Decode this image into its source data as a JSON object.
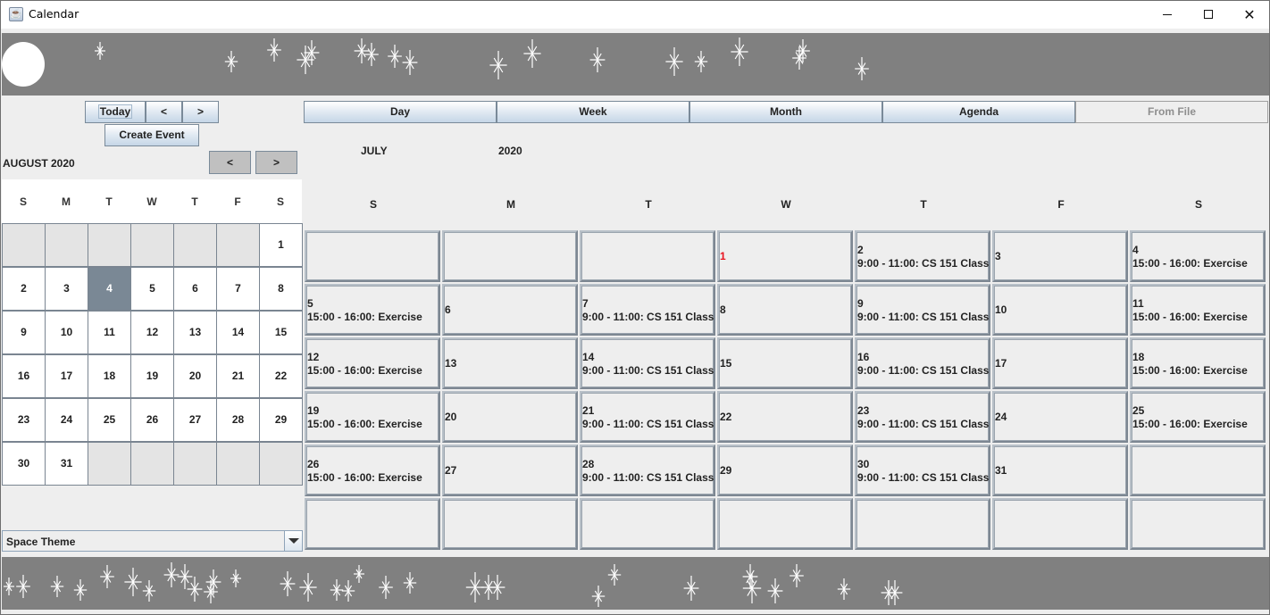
{
  "window": {
    "title": "Calendar",
    "icon": "java-cup-icon",
    "controls": {
      "minimize": "minimize-icon",
      "maximize": "maximize-icon",
      "close": "close-icon"
    }
  },
  "theme_colors": {
    "banner": "#808080",
    "stars": "#ffffff",
    "selected_day": "#7a8895",
    "today_text": "#e8121e",
    "background": "#eeeeee"
  },
  "sidebar": {
    "nav": {
      "today_label": "Today",
      "prev_label": "<",
      "next_label": ">"
    },
    "create_event_label": "Create Event",
    "mini_calendar": {
      "title": "AUGUST 2020",
      "prev_label": "<",
      "next_label": ">",
      "day_headers": [
        "S",
        "M",
        "T",
        "W",
        "T",
        "F",
        "S"
      ],
      "selected_day": "4",
      "weeks": [
        [
          "",
          "",
          "",
          "",
          "",
          "",
          "1"
        ],
        [
          "2",
          "3",
          "4",
          "5",
          "6",
          "7",
          "8"
        ],
        [
          "9",
          "10",
          "11",
          "12",
          "13",
          "14",
          "15"
        ],
        [
          "16",
          "17",
          "18",
          "19",
          "20",
          "21",
          "22"
        ],
        [
          "23",
          "24",
          "25",
          "26",
          "27",
          "28",
          "29"
        ],
        [
          "30",
          "31",
          "",
          "",
          "",
          "",
          ""
        ]
      ]
    },
    "theme_select": {
      "value": "Space Theme"
    }
  },
  "view_tabs": [
    {
      "label": "Day",
      "enabled": true
    },
    {
      "label": "Week",
      "enabled": true
    },
    {
      "label": "Month",
      "enabled": true
    },
    {
      "label": "Agenda",
      "enabled": true
    },
    {
      "label": "From File",
      "enabled": false
    }
  ],
  "month_view": {
    "month": "JULY",
    "year": "2020",
    "day_headers": [
      "S",
      "M",
      "T",
      "W",
      "T",
      "F",
      "S"
    ],
    "today": "1",
    "weeks": [
      [
        {
          "day": "",
          "event": ""
        },
        {
          "day": "",
          "event": ""
        },
        {
          "day": "",
          "event": ""
        },
        {
          "day": "1",
          "event": ""
        },
        {
          "day": "2",
          "event": "9:00 - 11:00: CS 151 Class"
        },
        {
          "day": "3",
          "event": ""
        },
        {
          "day": "4",
          "event": "15:00 - 16:00: Exercise"
        }
      ],
      [
        {
          "day": "5",
          "event": "15:00 - 16:00: Exercise"
        },
        {
          "day": "6",
          "event": ""
        },
        {
          "day": "7",
          "event": "9:00 - 11:00: CS 151 Class"
        },
        {
          "day": "8",
          "event": ""
        },
        {
          "day": "9",
          "event": "9:00 - 11:00: CS 151 Class"
        },
        {
          "day": "10",
          "event": ""
        },
        {
          "day": "11",
          "event": "15:00 - 16:00: Exercise"
        }
      ],
      [
        {
          "day": "12",
          "event": "15:00 - 16:00: Exercise"
        },
        {
          "day": "13",
          "event": ""
        },
        {
          "day": "14",
          "event": "9:00 - 11:00: CS 151 Class"
        },
        {
          "day": "15",
          "event": ""
        },
        {
          "day": "16",
          "event": "9:00 - 11:00: CS 151 Class"
        },
        {
          "day": "17",
          "event": ""
        },
        {
          "day": "18",
          "event": "15:00 - 16:00: Exercise"
        }
      ],
      [
        {
          "day": "19",
          "event": "15:00 - 16:00: Exercise"
        },
        {
          "day": "20",
          "event": ""
        },
        {
          "day": "21",
          "event": "9:00 - 11:00: CS 151 Class"
        },
        {
          "day": "22",
          "event": ""
        },
        {
          "day": "23",
          "event": "9:00 - 11:00: CS 151 Class"
        },
        {
          "day": "24",
          "event": ""
        },
        {
          "day": "25",
          "event": "15:00 - 16:00: Exercise"
        }
      ],
      [
        {
          "day": "26",
          "event": "15:00 - 16:00: Exercise"
        },
        {
          "day": "27",
          "event": ""
        },
        {
          "day": "28",
          "event": "9:00 - 11:00: CS 151 Class"
        },
        {
          "day": "29",
          "event": ""
        },
        {
          "day": "30",
          "event": "9:00 - 11:00: CS 151 Class"
        },
        {
          "day": "31",
          "event": ""
        },
        {
          "day": "",
          "event": ""
        }
      ],
      [
        {
          "day": "",
          "event": ""
        },
        {
          "day": "",
          "event": ""
        },
        {
          "day": "",
          "event": ""
        },
        {
          "day": "",
          "event": ""
        },
        {
          "day": "",
          "event": ""
        },
        {
          "day": "",
          "event": ""
        },
        {
          "day": "",
          "event": ""
        }
      ]
    ]
  },
  "decorations": {
    "top_banner": [
      "moon-icon",
      "star-icon"
    ],
    "bottom_banner": [
      "star-icon"
    ]
  }
}
